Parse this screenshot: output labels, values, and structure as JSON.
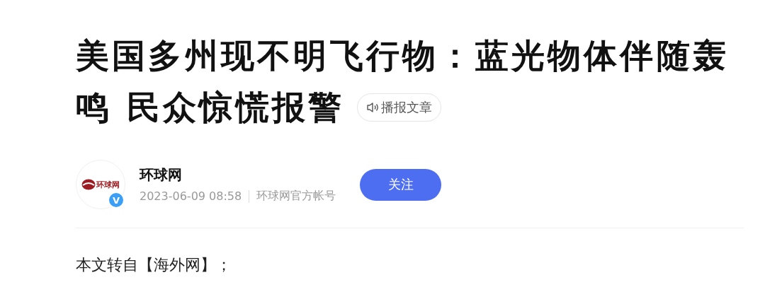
{
  "article": {
    "title_lines": [
      "美国多州现不明飞行物：蓝光物体伴随轰",
      "鸣 民众惊慌报警"
    ],
    "listen_button": "播报文章"
  },
  "author": {
    "logo_text": "环球网",
    "verified_badge": "V",
    "name": "环球网",
    "time": "2023-06-09 08:58",
    "account": "环球网官方帐号",
    "follow_button": "关注"
  },
  "body": [
    "本文转自【海外网】；"
  ]
}
